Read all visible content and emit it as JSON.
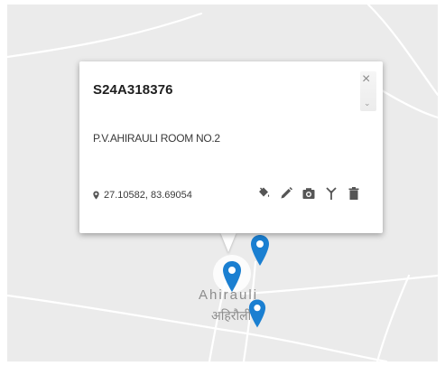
{
  "popup": {
    "title": "S24A318376",
    "subtitle": "P.V.AHIRAULI ROOM NO.2",
    "coordinates": "27.10582, 83.69054",
    "close_label": "×",
    "scroll_label": "⌄",
    "actions": [
      {
        "name": "paint-bucket-icon"
      },
      {
        "name": "pencil-icon"
      },
      {
        "name": "camera-icon"
      },
      {
        "name": "antenna-icon"
      },
      {
        "name": "trash-icon"
      }
    ]
  },
  "map": {
    "place_label_en": "Ahirauli",
    "place_label_hi": "अहिरौली",
    "marker_color": "#1a7fd1"
  }
}
